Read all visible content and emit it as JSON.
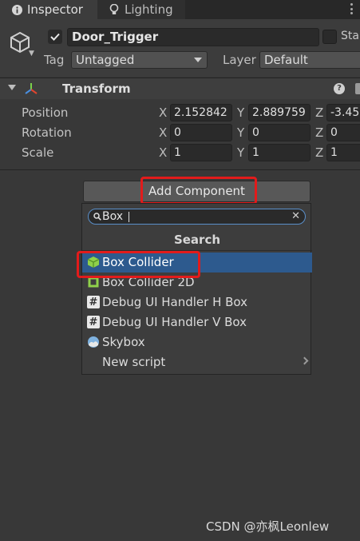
{
  "tabs": [
    {
      "label": "Inspector",
      "icon": "info-icon"
    },
    {
      "label": "Lighting",
      "icon": "lightbulb-icon"
    }
  ],
  "header": {
    "object_name": "Door_Trigger",
    "active": true,
    "static_label": "Sta",
    "tag_label": "Tag",
    "tag_value": "Untagged",
    "layer_label": "Layer",
    "layer_value": "Default"
  },
  "transform": {
    "title": "Transform",
    "rows": [
      {
        "label": "Position",
        "x": "2.152842",
        "y": "2.889759",
        "z": "-3.45"
      },
      {
        "label": "Rotation",
        "x": "0",
        "y": "0",
        "z": "0"
      },
      {
        "label": "Scale",
        "x": "1",
        "y": "1",
        "z": "1"
      }
    ],
    "axis_labels": [
      "X",
      "Y",
      "Z"
    ]
  },
  "add_component": {
    "button_label": "Add Component",
    "search_value": "Box",
    "popup_title": "Search",
    "items": [
      {
        "label": "Box Collider",
        "icon": "box-collider-icon",
        "selected": true
      },
      {
        "label": "Box Collider 2D",
        "icon": "box-collider-2d-icon",
        "selected": false
      },
      {
        "label": "Debug UI Handler H Box",
        "icon": "script-icon",
        "selected": false
      },
      {
        "label": "Debug UI Handler V Box",
        "icon": "script-icon",
        "selected": false
      },
      {
        "label": "Skybox",
        "icon": "skybox-icon",
        "selected": false
      },
      {
        "label": "New script",
        "icon": "",
        "selected": false
      }
    ]
  },
  "watermark": "CSDN @亦枫Leonlew",
  "colors": {
    "accent": "#2d5a8e",
    "highlight_box": "#e21b1b",
    "panel": "#383838"
  }
}
